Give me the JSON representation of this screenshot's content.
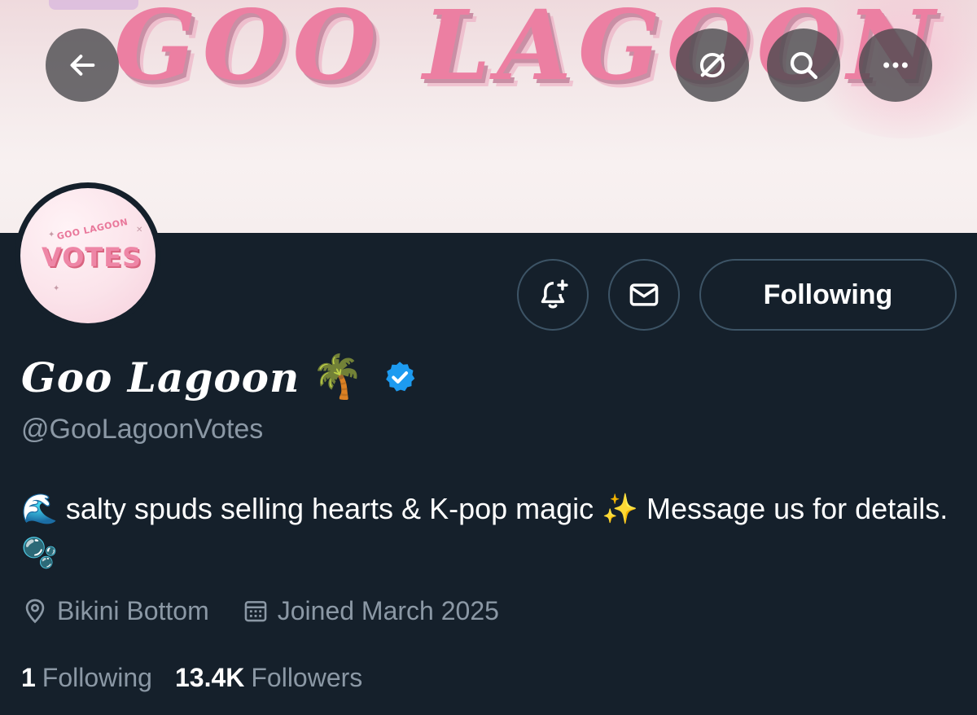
{
  "banner": {
    "title_text": "GOO LAGOON",
    "title_color": "#ec7fa2"
  },
  "header_buttons": {
    "back": "arrow-left-icon",
    "grok": "slash-circle-icon",
    "search": "search-icon",
    "more": "more-horizontal-icon"
  },
  "avatar": {
    "top_text": "GOO LAGOON",
    "main_text": "VOTES"
  },
  "actions": {
    "notify_icon": "bell-plus-icon",
    "message_icon": "mail-icon",
    "following_label": "Following"
  },
  "profile": {
    "display_name": "Goo Lagoon",
    "name_emoji": "🌴",
    "verified": true,
    "verified_color": "#1d9bf0",
    "handle": "@GooLagoonVotes",
    "bio_prefix_emoji": "🌊",
    "bio_part1": "salty spuds selling hearts & K-pop magic",
    "bio_sparkle_emoji": "✨",
    "bio_part2": "Message us for details.",
    "bio_bubbles_emoji": "🫧",
    "location": "Bikini Bottom",
    "joined": "Joined March 2025"
  },
  "stats": {
    "following_count": "1",
    "following_label": "Following",
    "followers_count": "13.4K",
    "followers_label": "Followers"
  },
  "colors": {
    "background": "#15202b",
    "secondary_text": "#8b98a5",
    "border": "#3d5466"
  }
}
